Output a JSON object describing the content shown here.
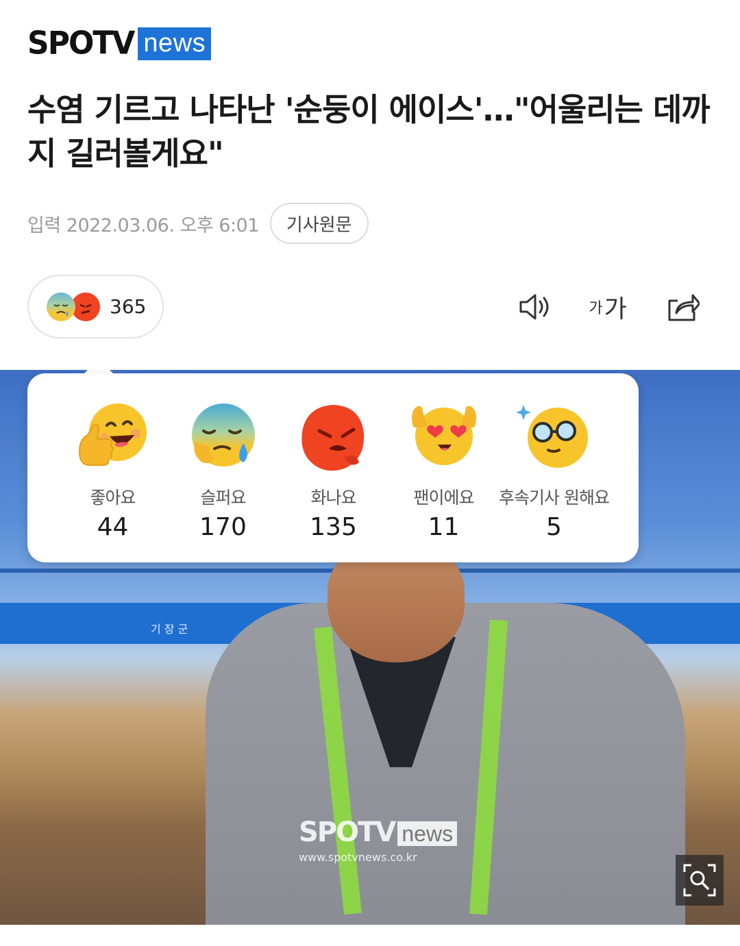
{
  "brand": {
    "part1": "SPOTV",
    "part2": "news"
  },
  "article": {
    "title": "수염 기르고 나타난 '순둥이 에이스'…\"어울리는 데까지 길러볼게요\"",
    "date": "입력 2022.03.06. 오후 6:01",
    "source_button": "기사원문"
  },
  "reaction_summary": {
    "count": "365",
    "icons": [
      "sad-face-icon",
      "angry-face-icon"
    ]
  },
  "toolbar": {
    "audio_icon": "speaker-icon",
    "font_small": "가",
    "font_large": "가",
    "share_icon": "share-icon"
  },
  "reactions": [
    {
      "label": "좋아요",
      "count": "44",
      "icon": "thumbs-up-face-icon"
    },
    {
      "label": "슬퍼요",
      "count": "170",
      "icon": "sad-face-icon"
    },
    {
      "label": "화나요",
      "count": "135",
      "icon": "angry-face-icon"
    },
    {
      "label": "팬이에요",
      "count": "11",
      "icon": "heart-eyes-face-icon"
    },
    {
      "label": "후속기사 원해요",
      "count": "5",
      "icon": "glasses-face-icon"
    }
  ],
  "photo": {
    "watermark_brand": "SPOTV",
    "watermark_news": "news",
    "watermark_url": "www.spotvnews.co.kr",
    "fence_text": "기 장 군",
    "zoom_icon": "zoom-icon"
  },
  "colors": {
    "brand_blue": "#1e73d9",
    "angry_red": "#ef4322",
    "emoji_yellow": "#f7c52b"
  }
}
